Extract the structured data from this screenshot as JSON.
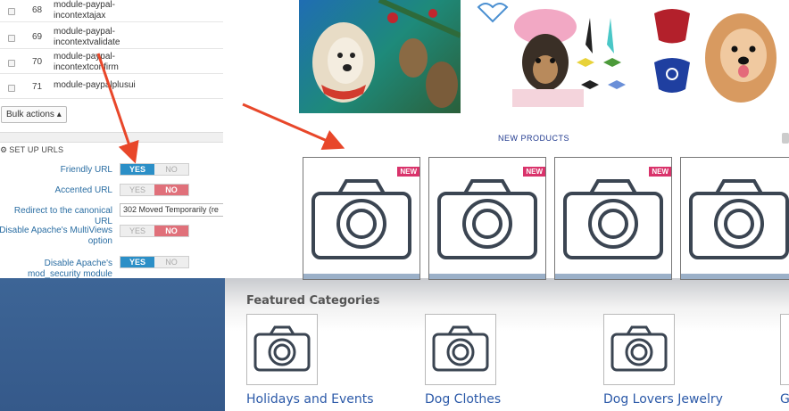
{
  "admin": {
    "rows": [
      {
        "num": "68",
        "module": "module-paypal-incontextajax"
      },
      {
        "num": "69",
        "module": "module-paypal-incontextvalidate"
      },
      {
        "num": "70",
        "module": "module-paypal-incontextconfirm"
      },
      {
        "num": "71",
        "module": "module-paypalplusui"
      }
    ],
    "bulk_label": "Bulk actions",
    "section_title": "SET UP URLS",
    "options": [
      {
        "label": "Friendly URL",
        "yes": "YES",
        "no": "NO",
        "selected": "yes"
      },
      {
        "label": "Accented URL",
        "yes": "YES",
        "no": "NO",
        "selected": "no"
      },
      {
        "label": "Disable Apache's MultiViews option",
        "yes": "YES",
        "no": "NO",
        "selected": "no"
      },
      {
        "label": "Disable Apache's mod_security module",
        "yes": "YES",
        "no": "NO",
        "selected": "yes"
      }
    ],
    "redirect_label": "Redirect to the canonical URL",
    "redirect_value": "302 Moved Temporarily (re"
  },
  "shop": {
    "new_products_title": "NEW PRODUCTS",
    "badge": "NEW"
  },
  "storefront": {
    "featured_title": "Featured Categories",
    "categories": [
      "Holidays and Events",
      "Dog Clothes",
      "Dog Lovers Jewelry",
      "G"
    ]
  },
  "colors": {
    "toggle_yes": "#2b8fc7",
    "toggle_no": "#e0707a",
    "link": "#2b59a8",
    "badge": "#d9336b",
    "arrow": "#e8472a"
  }
}
